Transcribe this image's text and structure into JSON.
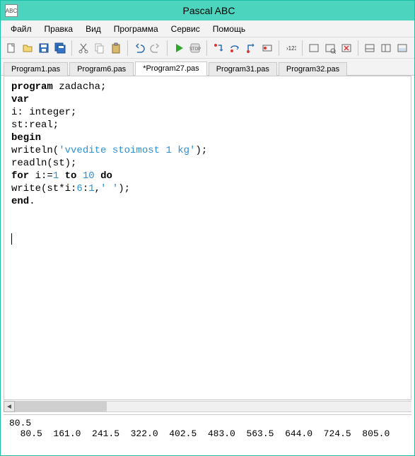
{
  "title": "Pascal ABC",
  "titleIconText": "ABC",
  "menu": [
    "Файл",
    "Правка",
    "Вид",
    "Программа",
    "Сервис",
    "Помощь"
  ],
  "tabs": [
    {
      "label": "Program1.pas",
      "active": false
    },
    {
      "label": "Program6.pas",
      "active": false
    },
    {
      "label": "*Program27.pas",
      "active": true
    },
    {
      "label": "Program31.pas",
      "active": false
    },
    {
      "label": "Program32.pas",
      "active": false
    }
  ],
  "code": {
    "line1_kw": "program",
    "line1_rest": " zadacha;",
    "line2_kw": "var",
    "line3": "i: integer;",
    "line4": "st:real;",
    "line5_kw": "begin",
    "line6_a": "writeln(",
    "line6_str": "'vvedite stoimost 1 kg'",
    "line6_b": ");",
    "line7": "readln(st);",
    "line8_kw": "for",
    "line8_a": " i:=",
    "line8_n1": "1",
    "line8_b": " ",
    "line8_kw2": "to",
    "line8_c": " ",
    "line8_n2": "10",
    "line8_d": " ",
    "line8_kw3": "do",
    "line9_a": "write(st*i:",
    "line9_n1": "6",
    "line9_b": ":",
    "line9_n2": "1",
    "line9_c": ",",
    "line9_str": "' '",
    "line9_d": ");",
    "line10_kw": "end",
    "line10_rest": "."
  },
  "output_line1": "80.5",
  "output_line2": "  80.5  161.0  241.5  322.0  402.5  483.0  563.5  644.0  724.5  805.0"
}
